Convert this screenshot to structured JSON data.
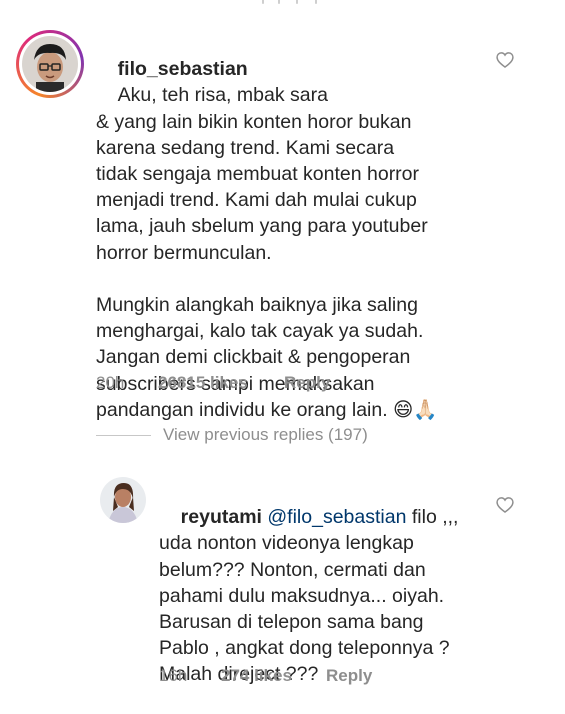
{
  "comments": [
    {
      "username": "filo_sebastian",
      "text": "Aku, teh risa, mbak sara\n& yang lain bikin konten horor bukan\nkarena sedang trend. Kami secara\ntidak sengaja membuat konten horror\nmenjadi trend. Kami dah mulai cukup\nlama, jauh sbelum yang para youtuber\nhorror bermunculan.\n\nMungkin alangkah baiknya jika saling\nmenghargai, kalo tak cayak ya sudah.\nJangan demi clickbait & pengoperan\nsubscribers sampi memaksakan\npandangan individu ke orang lain. 😄🙏🏻",
      "time": "20h",
      "likes": "26815 likes",
      "reply": "Reply"
    }
  ],
  "replies_toggle": "View previous replies (197)",
  "reply": {
    "username": "reyutami",
    "mention": "@filo_sebastian",
    "text": " filo ,,,\nuda nonton videonya lengkap\nbelum??? Nonton, cermati dan\npahami dulu maksudnya... oiyah.\nBarusan di telepon sama bang\nPablo , angkat dong teleponnya ?\nMalah direject ???",
    "time": "16h",
    "likes": "274 likes",
    "reply_label": "Reply"
  },
  "icons": {
    "like": "heart-outline-icon"
  }
}
